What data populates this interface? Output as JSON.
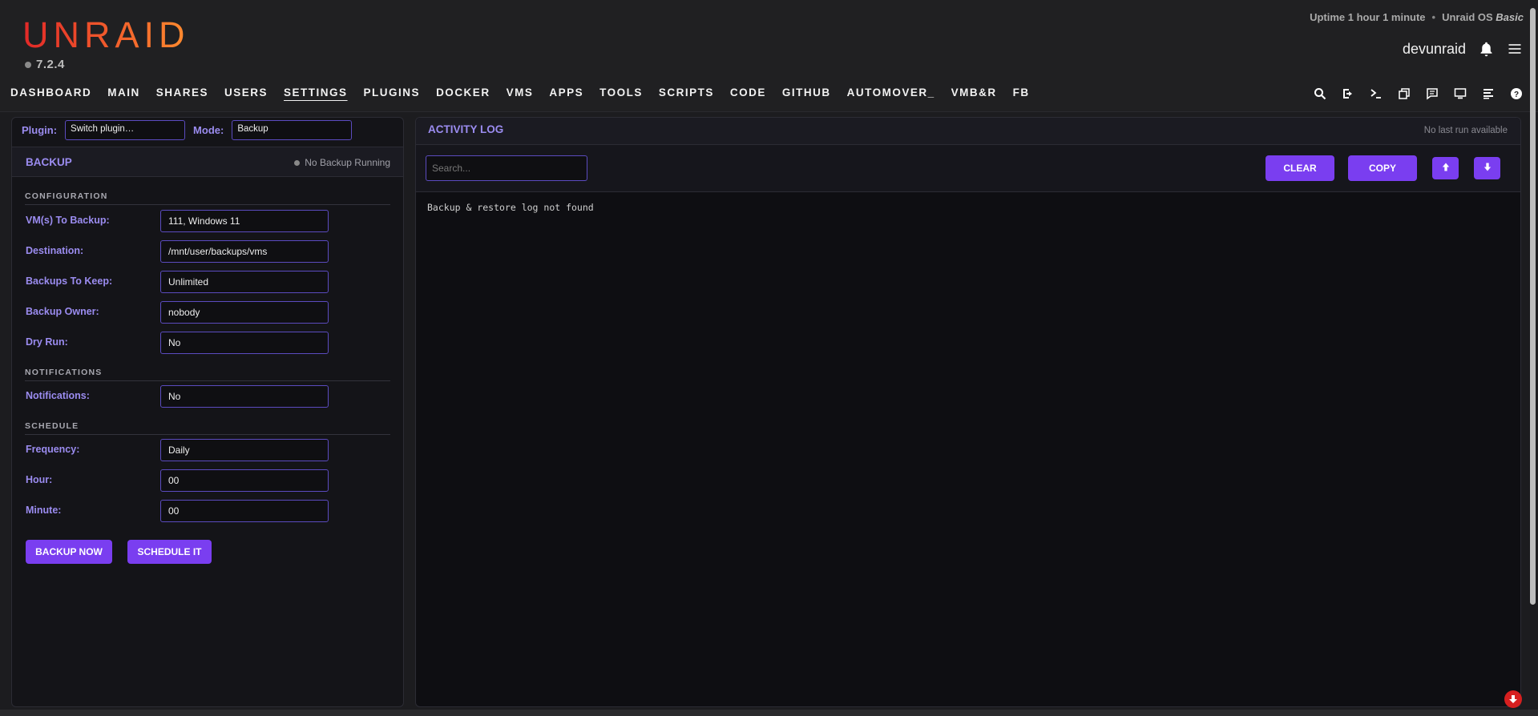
{
  "app": {
    "logo": "UNRAID",
    "version": "7.2.4",
    "uptime": "Uptime 1 hour 1 minute",
    "separator": "•",
    "os_label": "Unraid OS",
    "os_edition": "Basic",
    "username": "devunraid"
  },
  "nav": {
    "items": [
      "DASHBOARD",
      "MAIN",
      "SHARES",
      "USERS",
      "SETTINGS",
      "PLUGINS",
      "DOCKER",
      "VMS",
      "APPS",
      "TOOLS",
      "SCRIPTS",
      "CODE",
      "GITHUB",
      "AUTOMOVER_",
      "VMB&R",
      "FB"
    ],
    "active": "SETTINGS",
    "icons": [
      "search-icon",
      "logout-icon",
      "terminal-icon",
      "copy-windows-icon",
      "feedback-icon",
      "monitor-icon",
      "log-icon",
      "help-icon"
    ]
  },
  "left": {
    "plugin_label": "Plugin:",
    "plugin_value": "Switch plugin…",
    "mode_label": "Mode:",
    "mode_value": "Backup",
    "section_title": "BACKUP",
    "status": "No Backup Running",
    "groups": {
      "configuration": "CONFIGURATION",
      "notifications": "NOTIFICATIONS",
      "schedule": "SCHEDULE"
    },
    "fields": {
      "vms": {
        "label": "VM(s) To Backup:",
        "value": "111, Windows 11"
      },
      "destination": {
        "label": "Destination:",
        "value": "/mnt/user/backups/vms"
      },
      "keep": {
        "label": "Backups To Keep:",
        "value": "Unlimited"
      },
      "owner": {
        "label": "Backup Owner:",
        "value": "nobody"
      },
      "dryrun": {
        "label": "Dry Run:",
        "value": "No"
      },
      "notifications": {
        "label": "Notifications:",
        "value": "No"
      },
      "frequency": {
        "label": "Frequency:",
        "value": "Daily"
      },
      "hour": {
        "label": "Hour:",
        "value": "00"
      },
      "minute": {
        "label": "Minute:",
        "value": "00"
      }
    },
    "buttons": {
      "backup_now": "BACKUP NOW",
      "schedule_it": "SCHEDULE IT"
    }
  },
  "right": {
    "title": "ACTIVITY LOG",
    "last_run": "No last run available",
    "search_placeholder": "Search...",
    "clear": "CLEAR",
    "copy": "COPY",
    "log_text": "Backup & restore log not found"
  },
  "colors": {
    "accent": "#7a3ef0",
    "label": "#9b8cf0",
    "logo_start": "#e22828",
    "logo_end": "#ff8c2f"
  }
}
